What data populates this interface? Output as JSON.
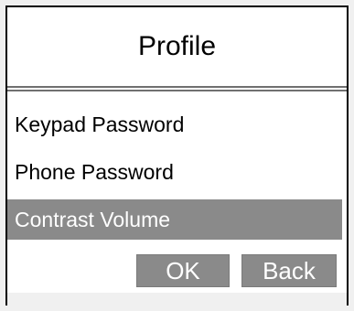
{
  "dialog": {
    "title": "Profile",
    "menu": {
      "items": [
        {
          "label": "Keypad Password",
          "selected": false
        },
        {
          "label": "Phone Password",
          "selected": false
        },
        {
          "label": "Contrast Volume",
          "selected": true
        }
      ]
    },
    "buttons": {
      "ok_label": "OK",
      "back_label": "Back"
    }
  },
  "colors": {
    "background": "#f0f0f0",
    "panel": "#ffffff",
    "selection": "#8a8a8a",
    "text": "#000000",
    "selected_text": "#ffffff"
  }
}
